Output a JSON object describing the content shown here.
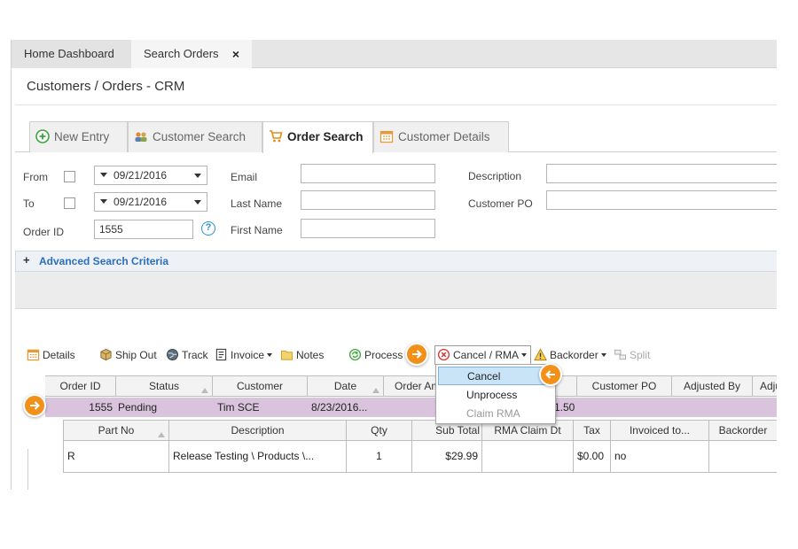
{
  "tabs": {
    "home": "Home Dashboard",
    "search": "Search Orders",
    "close": "×"
  },
  "page_title": "Customers / Orders - CRM",
  "subtabs": {
    "new_entry": "New Entry",
    "customer_search": "Customer Search",
    "order_search": "Order Search",
    "customer_details": "Customer Details"
  },
  "form": {
    "from_label": "From",
    "to_label": "To",
    "order_id_label": "Order ID",
    "from_date": "09/21/2016",
    "to_date": "09/21/2016",
    "order_id_value": "1555",
    "email_label": "Email",
    "last_name_label": "Last Name",
    "first_name_label": "First Name",
    "description_label": "Description",
    "customer_po_label": "Customer PO",
    "help": "?"
  },
  "advanced": {
    "plus": "+",
    "label": "Advanced Search Criteria"
  },
  "toolbar": {
    "details": "Details",
    "ship_out": "Ship Out",
    "track": "Track",
    "invoice": "Invoice",
    "notes": "Notes",
    "process": "Process",
    "cancel_rma": "Cancel / RMA",
    "backorder": "Backorder",
    "split": "Split"
  },
  "dropdown": {
    "items": [
      "Cancel",
      "Unprocess",
      "Claim RMA"
    ]
  },
  "grid": {
    "headers": [
      "Order ID",
      "Status",
      "Customer",
      "Date",
      "Order Am",
      "",
      "Customer PO",
      "Adjusted By",
      "Adju"
    ],
    "row": {
      "order_id": "1555",
      "status": "Pending",
      "customer": "Tim SCE",
      "date": "8/23/2016...",
      "amount_fragment": "1.50"
    }
  },
  "subgrid": {
    "headers": [
      "Part No",
      "Description",
      "Qty",
      "Sub Total",
      "RMA Claim Dt",
      "Tax",
      "Invoiced to...",
      "Backorder"
    ],
    "row": [
      "R",
      "Release Testing \\ Products \\...",
      "1",
      "$29.99",
      "",
      "$0.00",
      "no",
      ""
    ]
  },
  "colors": {
    "accent": "#f39019",
    "selected_row": "#d9c3dd",
    "link": "#2a6fc0"
  }
}
